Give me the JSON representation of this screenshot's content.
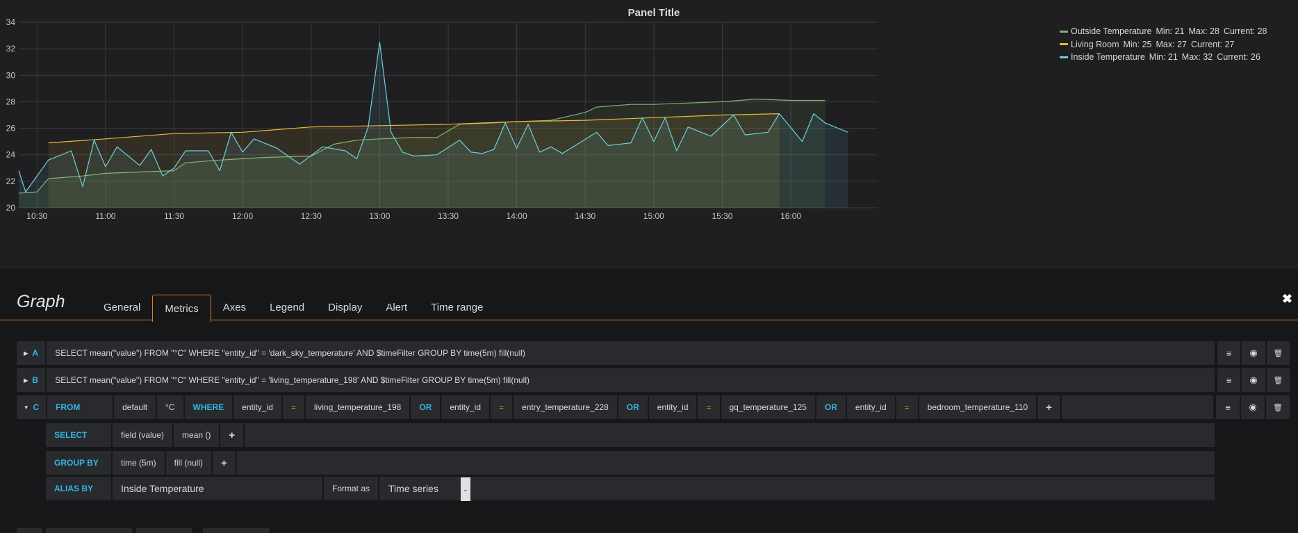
{
  "panel": {
    "title": "Panel Title"
  },
  "chart_data": {
    "type": "line",
    "title": "Panel Title",
    "ylim": [
      20,
      34
    ],
    "yticks": [
      "20",
      "22",
      "24",
      "26",
      "28",
      "30",
      "32",
      "34"
    ],
    "xticks": [
      "10:30",
      "11:00",
      "11:30",
      "12:00",
      "12:30",
      "13:00",
      "13:30",
      "14:00",
      "14:30",
      "15:00",
      "15:30",
      "16:00"
    ],
    "x_range": [
      "10:22",
      "16:38"
    ],
    "grid": true,
    "legend_placement": "right",
    "series": [
      {
        "name": "Outside Temperature",
        "color": "#7eb26d",
        "stats": {
          "min": "Min: 21",
          "max": "Max: 28",
          "current": "Current: 28"
        },
        "points": [
          [
            "10:22",
            21.1
          ],
          [
            "10:30",
            21.2
          ],
          [
            "10:35",
            22.2
          ],
          [
            "10:50",
            22.4
          ],
          [
            "11:00",
            22.6
          ],
          [
            "11:15",
            22.7
          ],
          [
            "11:30",
            22.8
          ],
          [
            "11:35",
            23.4
          ],
          [
            "11:50",
            23.6
          ],
          [
            "12:00",
            23.7
          ],
          [
            "12:10",
            23.8
          ],
          [
            "12:30",
            23.9
          ],
          [
            "12:40",
            24.8
          ],
          [
            "12:50",
            25.1
          ],
          [
            "13:00",
            25.2
          ],
          [
            "13:15",
            25.3
          ],
          [
            "13:25",
            25.3
          ],
          [
            "13:35",
            26.3
          ],
          [
            "13:50",
            26.4
          ],
          [
            "14:00",
            26.5
          ],
          [
            "14:15",
            26.6
          ],
          [
            "14:30",
            27.2
          ],
          [
            "14:35",
            27.6
          ],
          [
            "14:50",
            27.8
          ],
          [
            "15:00",
            27.8
          ],
          [
            "15:30",
            28.0
          ],
          [
            "15:45",
            28.2
          ],
          [
            "16:00",
            28.1
          ],
          [
            "16:15",
            28.1
          ]
        ]
      },
      {
        "name": "Living Room",
        "color": "#eab839",
        "stats": {
          "min": "Min: 25",
          "max": "Max: 27",
          "current": "Current: 27"
        },
        "points": [
          [
            "10:35",
            24.9
          ],
          [
            "11:00",
            25.2
          ],
          [
            "11:30",
            25.6
          ],
          [
            "12:00",
            25.7
          ],
          [
            "12:30",
            26.1
          ],
          [
            "13:00",
            26.2
          ],
          [
            "13:30",
            26.3
          ],
          [
            "14:00",
            26.5
          ],
          [
            "14:30",
            26.6
          ],
          [
            "15:00",
            26.8
          ],
          [
            "15:30",
            27.0
          ],
          [
            "15:55",
            27.1
          ]
        ]
      },
      {
        "name": "Inside Temperature",
        "color": "#6ed0e0",
        "stats": {
          "min": "Min: 21",
          "max": "Max: 32",
          "current": "Current: 26"
        },
        "points": [
          [
            "10:22",
            22.8
          ],
          [
            "10:25",
            21.2
          ],
          [
            "10:35",
            23.6
          ],
          [
            "10:45",
            24.3
          ],
          [
            "10:50",
            21.6
          ],
          [
            "10:55",
            25.1
          ],
          [
            "11:00",
            23.1
          ],
          [
            "11:05",
            24.6
          ],
          [
            "11:15",
            23.2
          ],
          [
            "11:20",
            24.4
          ],
          [
            "11:25",
            22.4
          ],
          [
            "11:30",
            23.0
          ],
          [
            "11:35",
            24.3
          ],
          [
            "11:45",
            24.3
          ],
          [
            "11:50",
            22.8
          ],
          [
            "11:55",
            25.7
          ],
          [
            "12:00",
            24.2
          ],
          [
            "12:05",
            25.2
          ],
          [
            "12:15",
            24.5
          ],
          [
            "12:25",
            23.3
          ],
          [
            "12:35",
            24.6
          ],
          [
            "12:45",
            24.3
          ],
          [
            "12:50",
            23.7
          ],
          [
            "12:55",
            26.1
          ],
          [
            "13:00",
            32.5
          ],
          [
            "13:05",
            25.7
          ],
          [
            "13:10",
            24.2
          ],
          [
            "13:15",
            23.9
          ],
          [
            "13:25",
            24.0
          ],
          [
            "13:35",
            25.1
          ],
          [
            "13:40",
            24.2
          ],
          [
            "13:45",
            24.1
          ],
          [
            "13:50",
            24.4
          ],
          [
            "13:55",
            26.4
          ],
          [
            "14:00",
            24.5
          ],
          [
            "14:05",
            26.3
          ],
          [
            "14:10",
            24.2
          ],
          [
            "14:15",
            24.6
          ],
          [
            "14:20",
            24.1
          ],
          [
            "14:35",
            25.7
          ],
          [
            "14:40",
            24.7
          ],
          [
            "14:50",
            24.9
          ],
          [
            "14:55",
            26.8
          ],
          [
            "15:00",
            25.0
          ],
          [
            "15:05",
            26.8
          ],
          [
            "15:10",
            24.3
          ],
          [
            "15:15",
            26.1
          ],
          [
            "15:25",
            25.4
          ],
          [
            "15:35",
            27.0
          ],
          [
            "15:40",
            25.5
          ],
          [
            "15:50",
            25.7
          ],
          [
            "15:55",
            27.1
          ],
          [
            "16:05",
            25.0
          ],
          [
            "16:10",
            27.1
          ],
          [
            "16:15",
            26.4
          ],
          [
            "16:25",
            25.7
          ]
        ]
      }
    ]
  },
  "editor": {
    "title": "Graph",
    "tabs": [
      "General",
      "Metrics",
      "Axes",
      "Legend",
      "Display",
      "Alert",
      "Time range"
    ],
    "active_tab": "Metrics",
    "close_glyph": "✖",
    "queries": [
      {
        "letter": "A",
        "text": "SELECT mean(\"value\") FROM \"°C\" WHERE \"entity_id\" = 'dark_sky_temperature' AND $timeFilter GROUP BY time(5m) fill(null)"
      },
      {
        "letter": "B",
        "text": "SELECT mean(\"value\") FROM \"°C\" WHERE \"entity_id\" = 'living_temperature_198' AND $timeFilter GROUP BY time(5m) fill(null)"
      }
    ],
    "query_c": {
      "letter": "C",
      "from_label": "FROM",
      "from_segments": [
        {
          "t": "default",
          "k": "seg"
        },
        {
          "t": "°C",
          "k": "seg"
        },
        {
          "t": "WHERE",
          "k": "kw"
        },
        {
          "t": "entity_id",
          "k": "seg"
        },
        {
          "t": "=",
          "k": "op"
        },
        {
          "t": "living_temperature_198",
          "k": "seg"
        },
        {
          "t": "OR",
          "k": "kw"
        },
        {
          "t": "entity_id",
          "k": "seg"
        },
        {
          "t": "=",
          "k": "op"
        },
        {
          "t": "entry_temperature_228",
          "k": "seg"
        },
        {
          "t": "OR",
          "k": "kw"
        },
        {
          "t": "entity_id",
          "k": "seg"
        },
        {
          "t": "=",
          "k": "op"
        },
        {
          "t": "gq_temperature_125",
          "k": "seg"
        },
        {
          "t": "OR",
          "k": "kw"
        },
        {
          "t": "entity_id",
          "k": "seg"
        },
        {
          "t": "=",
          "k": "op"
        },
        {
          "t": "bedroom_temperature_110",
          "k": "seg"
        },
        {
          "t": "+",
          "k": "plus"
        }
      ],
      "select_label": "SELECT",
      "select_segments": [
        "field (value)",
        "mean ()"
      ],
      "groupby_label": "GROUP BY",
      "groupby_segments": [
        "time (5m)",
        "fill (null)"
      ],
      "alias_label": "ALIAS BY",
      "alias_value": "Inside Temperature",
      "format_label": "Format as",
      "format_value": "Time series",
      "plus": "+"
    }
  }
}
